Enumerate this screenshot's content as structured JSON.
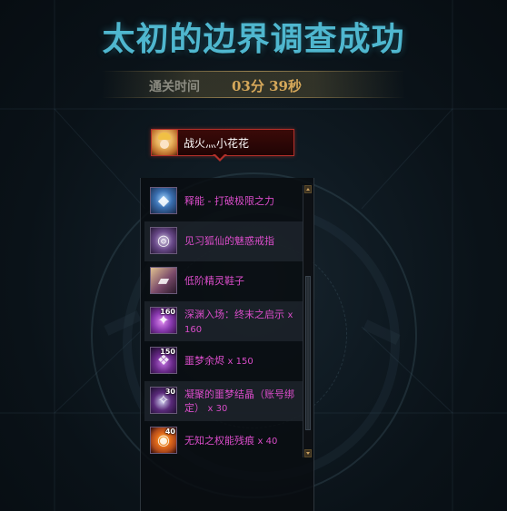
{
  "header": {
    "title": "太初的边界调查成功"
  },
  "clear_time": {
    "label": "通关时间",
    "value": "03分 39秒"
  },
  "player": {
    "name": "战火灬小花花"
  },
  "rewards": [
    {
      "name": "释能 - 打破极限之力",
      "quantity": "",
      "icon": "crystal-armor-icon",
      "icon_count": "",
      "icon_color": "#3a6fb0"
    },
    {
      "name": "见习狐仙的魅惑戒指",
      "quantity": "",
      "icon": "ring-icon",
      "icon_count": "",
      "icon_color": "#6a4a8a"
    },
    {
      "name": "低阶精灵鞋子",
      "quantity": "",
      "icon": "boots-icon",
      "icon_color": "#7a4a6a",
      "icon_count": ""
    },
    {
      "name": "深渊入场：终末之启示",
      "quantity": "x 160",
      "icon": "abyss-ticket-icon",
      "icon_count": "160",
      "icon_color": "#8a3ab0"
    },
    {
      "name": "噩梦余烬",
      "quantity": "x 150",
      "icon": "ember-icon",
      "icon_count": "150",
      "icon_color": "#6a2a8a"
    },
    {
      "name": "凝聚的噩梦结晶（账号绑定）",
      "quantity": "x 30",
      "icon": "nightmare-crystal-icon",
      "icon_count": "30",
      "icon_color": "#5a2a7a"
    },
    {
      "name": "无知之权能残痕",
      "quantity": "x 40",
      "icon": "fire-ring-icon",
      "icon_count": "40",
      "icon_color": "#b04a1a"
    }
  ],
  "colors": {
    "title": "#4fb7cf",
    "time_value": "#d6a85a",
    "reward_text": "#d94cc9",
    "player_tag_border": "#b4302a"
  }
}
